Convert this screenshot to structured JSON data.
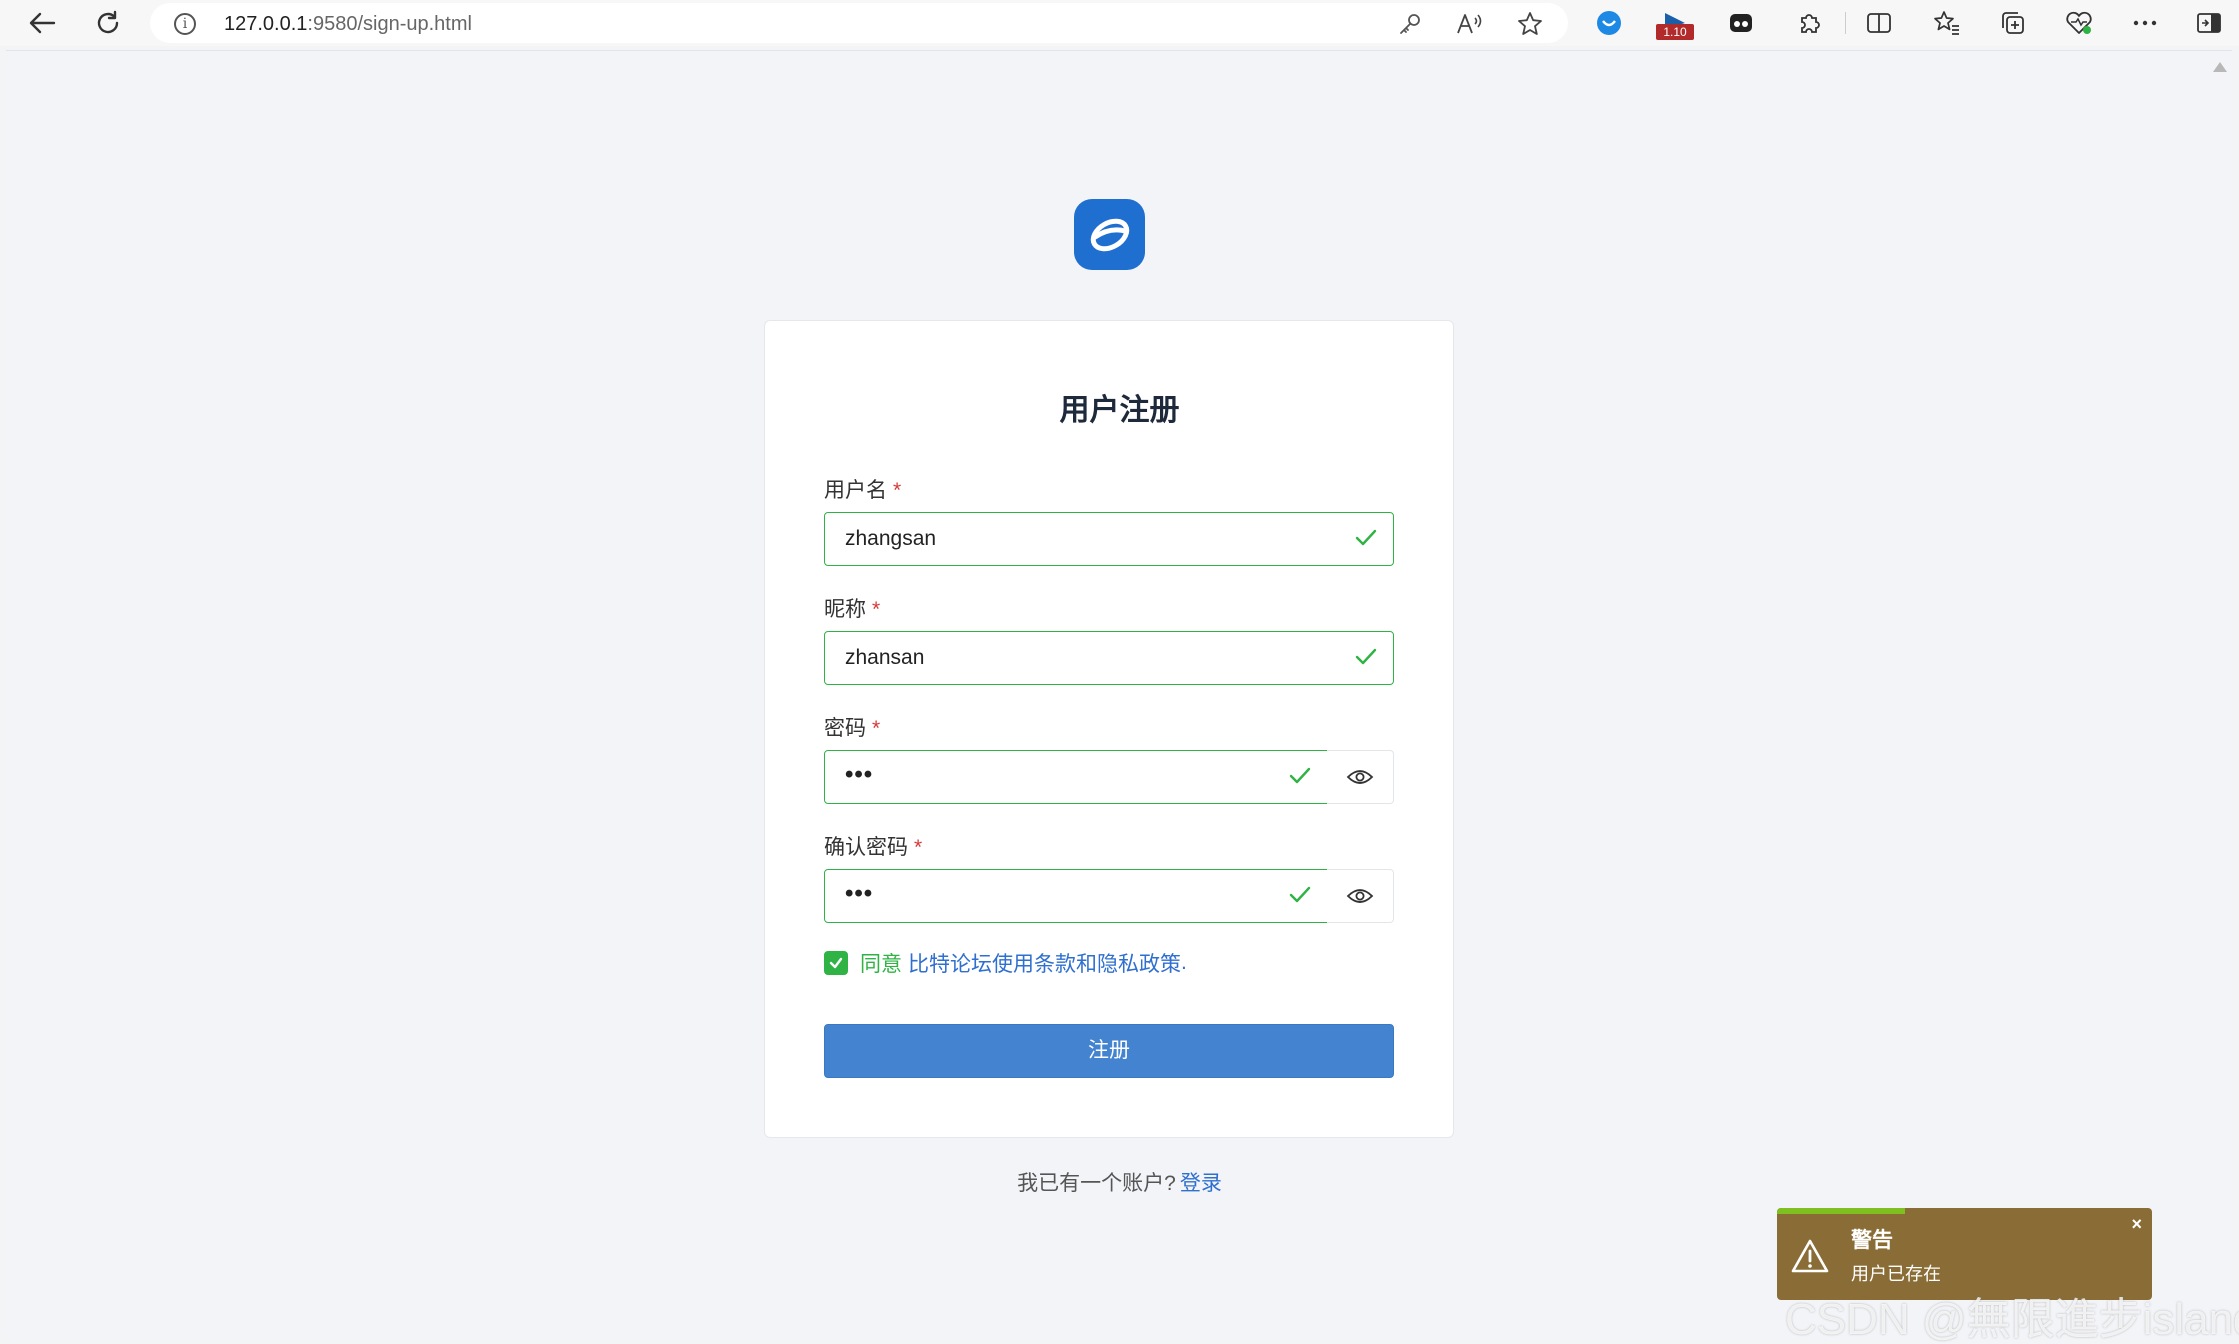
{
  "browser": {
    "url_host": "127.0.0.1",
    "url_path": ":9580/sign-up.html",
    "extension_badge": "1.10",
    "icons": {
      "back": "back-arrow-icon",
      "refresh": "refresh-icon",
      "site_info": "info-icon",
      "password": "key-icon",
      "read_aloud": "read-aloud-icon",
      "favorite": "star-icon",
      "more": "ellipsis-icon"
    }
  },
  "page": {
    "title": "用户注册",
    "brand_color": "#1f6fd1",
    "success_color": "#2fb344",
    "link_color": "#2f6fcf",
    "fields": {
      "username": {
        "label": "用户名",
        "required_mark": "*",
        "value": "zhangsan"
      },
      "nickname": {
        "label": "昵称",
        "required_mark": "*",
        "value": "zhansan"
      },
      "password": {
        "label": "密码",
        "required_mark": "*",
        "value": "•••"
      },
      "confirm_password": {
        "label": "确认密码",
        "required_mark": "*",
        "value": "•••"
      }
    },
    "agree": {
      "checked": true,
      "prefix": "同意",
      "link": "比特论坛使用条款和隐私政策",
      "suffix": "."
    },
    "submit_label": "注册",
    "login_hint": "我已有一个账户?",
    "login_link": "登录"
  },
  "toast": {
    "title": "警告",
    "message": "用户已存在",
    "close": "×",
    "progress": 0.34,
    "background": "#8a6d36"
  },
  "watermark": "CSDN @無限進步island"
}
